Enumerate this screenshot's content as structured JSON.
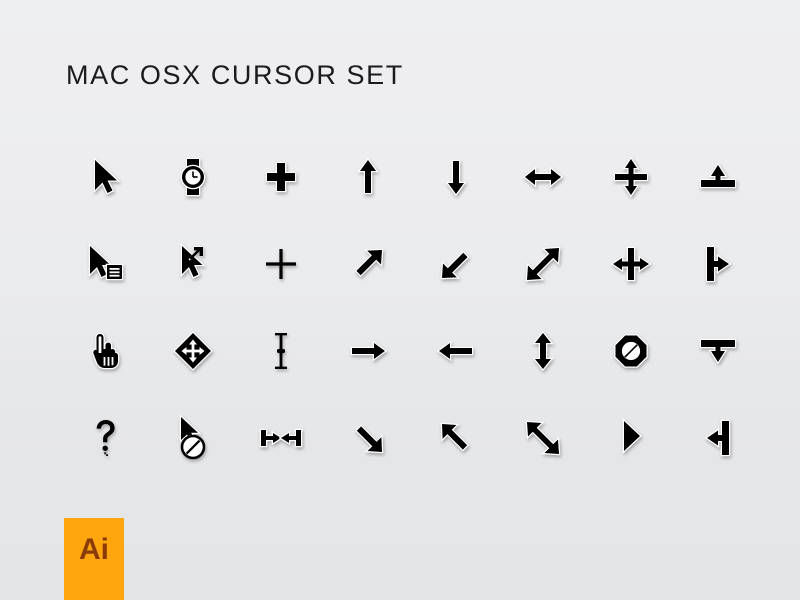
{
  "page": {
    "title": "MAC OSX CURSOR SET",
    "background_top_color": "#eeeff1",
    "background_bottom_color": "#e4e5e7"
  },
  "badge": {
    "label": "Ai",
    "background_color": "#ffa60e",
    "text_color": "#8a3b06",
    "name": "adobe-illustrator-badge"
  },
  "grid": {
    "columns": 8,
    "rows": 4,
    "count": 32,
    "cursors": [
      {
        "id": "arrow",
        "label": "Arrow Pointer"
      },
      {
        "id": "watch",
        "label": "Wristwatch Busy"
      },
      {
        "id": "plus-thick",
        "label": "Thick Plus Crosshair"
      },
      {
        "id": "arrow-up",
        "label": "Arrow Up"
      },
      {
        "id": "arrow-down",
        "label": "Arrow Down"
      },
      {
        "id": "arrow-left-right",
        "label": "Resize Left Right"
      },
      {
        "id": "resize-row",
        "label": "Resize Row Vertical Bar"
      },
      {
        "id": "resize-up-to-bar",
        "label": "Resize Up To Bar"
      },
      {
        "id": "arrow-contextual-menu",
        "label": "Arrow Contextual Menu"
      },
      {
        "id": "arrow-alias",
        "label": "Arrow Make Alias"
      },
      {
        "id": "plus-thin",
        "label": "Thin Plus Crosshair"
      },
      {
        "id": "arrow-up-right",
        "label": "Arrow Up Right"
      },
      {
        "id": "arrow-down-left",
        "label": "Arrow Down Left"
      },
      {
        "id": "resize-ne-sw",
        "label": "Resize Northeast Southwest"
      },
      {
        "id": "resize-column",
        "label": "Resize Column Horizontal Bar"
      },
      {
        "id": "resize-right-from-bar",
        "label": "Resize Right From Bar"
      },
      {
        "id": "pointing-hand",
        "label": "Pointing Hand"
      },
      {
        "id": "move-four-way",
        "label": "Move Four Way Diamond"
      },
      {
        "id": "ibeam",
        "label": "Text I-Beam"
      },
      {
        "id": "arrow-right",
        "label": "Arrow Right"
      },
      {
        "id": "arrow-left",
        "label": "Arrow Left"
      },
      {
        "id": "arrow-up-down",
        "label": "Resize Up Down"
      },
      {
        "id": "not-allowed",
        "label": "Operation Not Allowed"
      },
      {
        "id": "resize-down-from-bar",
        "label": "Resize Down From Bar"
      },
      {
        "id": "help-question",
        "label": "Help Question Mark"
      },
      {
        "id": "arrow-not-allowed",
        "label": "Arrow Not Allowed"
      },
      {
        "id": "resize-between-bars",
        "label": "Resize Between Bars"
      },
      {
        "id": "arrow-down-right",
        "label": "Arrow Down Right"
      },
      {
        "id": "arrow-up-left",
        "label": "Arrow Up Left"
      },
      {
        "id": "resize-nw-se",
        "label": "Resize Northwest Southeast"
      },
      {
        "id": "arrow-triangle-right",
        "label": "Triangle Pointer Right"
      },
      {
        "id": "resize-left-to-bar",
        "label": "Resize Left To Bar"
      }
    ]
  }
}
